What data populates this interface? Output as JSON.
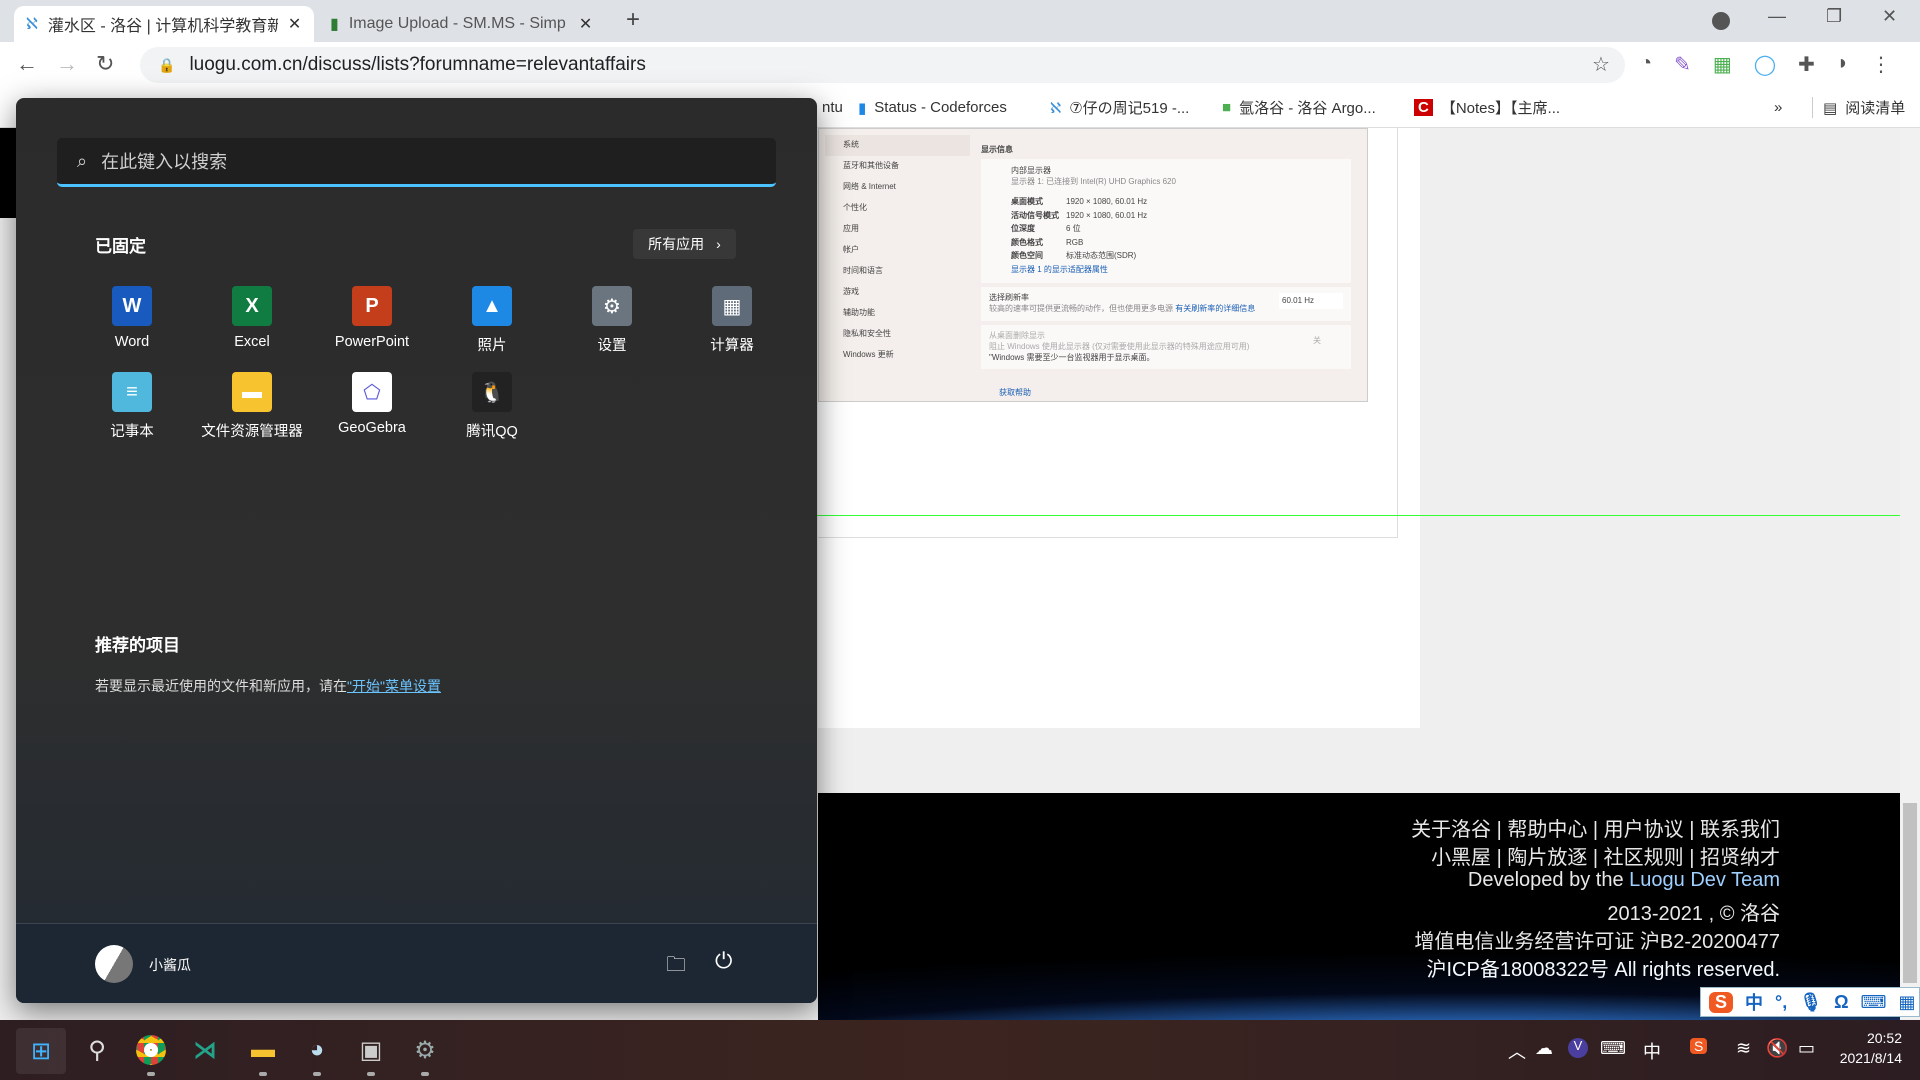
{
  "browser": {
    "tabs": [
      {
        "title": "灌水区 - 洛谷 | 计算机科学教育新",
        "active": true
      },
      {
        "title": "Image Upload - SM.MS - Simp",
        "active": false
      }
    ],
    "new_tab": "+",
    "url": "luogu.com.cn/discuss/lists?forumname=relevantaffairs",
    "bookmarks": [
      "ntu",
      "Status - Codeforces",
      "⑦仔の周记519 -...",
      "氩洛谷 - 洛谷 Argo...",
      "【Notes】【主席..."
    ],
    "more": "»",
    "reading_list": "阅读清单"
  },
  "screenshot_preview": {
    "nav": [
      "系统",
      "蓝牙和其他设备",
      "网络 & Internet",
      "个性化",
      "应用",
      "帐户",
      "时间和语言",
      "游戏",
      "辅助功能",
      "隐私和安全性",
      "Windows 更新"
    ],
    "section": "显示信息",
    "display_name": "内部显示器",
    "display_sub": "显示器 1: 已连接到 Intel(R) UHD Graphics 620",
    "rows": [
      [
        "桌面模式",
        "1920 × 1080, 60.01 Hz"
      ],
      [
        "活动信号模式",
        "1920 × 1080, 60.01 Hz"
      ],
      [
        "位深度",
        "6 位"
      ],
      [
        "颜色格式",
        "RGB"
      ],
      [
        "颜色空间",
        "标准动态范围(SDR)"
      ]
    ],
    "adapter_link": "显示器 1 的显示适配器属性",
    "refresh_title": "选择刷新率",
    "refresh_desc": "较高的速率可提供更流畅的动作，但也使用更多电源",
    "refresh_link": "有关刷新率的详细信息",
    "refresh_value": "60.01 Hz",
    "remove_title": "从桌面删除显示",
    "remove_desc": "阻止 Windows 使用此显示器 (仅对需要使用此显示器的特殊用途应用可用)",
    "remove_note": "\"Windows 需要至少一台监视器用于显示桌面。",
    "toggle": "关",
    "help": "获取帮助"
  },
  "footer": {
    "links1": "关于洛谷 | 帮助中心 | 用户协议 | 联系我们",
    "links2": "小黑屋 | 陶片放逐 | 社区规则 | 招贤纳才",
    "dev_prefix": "Developed by the ",
    "dev_team": "Luogu Dev Team",
    "copyright": "2013-2021 , © 洛谷",
    "license": "增值电信业务经营许可证 沪B2-20200477",
    "icp": "沪ICP备18008322号 All rights reserved."
  },
  "start_menu": {
    "search_placeholder": "在此键入以搜索",
    "pinned_title": "已固定",
    "all_apps": "所有应用",
    "apps": [
      {
        "label": "Word",
        "color": "#185abd",
        "glyph": "W"
      },
      {
        "label": "Excel",
        "color": "#107c41",
        "glyph": "X"
      },
      {
        "label": "PowerPoint",
        "color": "#c43e1c",
        "glyph": "P"
      },
      {
        "label": "照片",
        "color": "#1e88e5",
        "glyph": "▲"
      },
      {
        "label": "设置",
        "color": "#6b7580",
        "glyph": "⚙"
      },
      {
        "label": "计算器",
        "color": "#5f6b78",
        "glyph": "▦"
      },
      {
        "label": "记事本",
        "color": "#4fb8dc",
        "glyph": "≡"
      },
      {
        "label": "文件资源管理器",
        "color": "#f7c32e",
        "glyph": "▬"
      },
      {
        "label": "GeoGebra",
        "color": "#ffffff",
        "glyph": "⬠"
      },
      {
        "label": "腾讯QQ",
        "color": "#222222",
        "glyph": "🐧"
      }
    ],
    "recommended_title": "推荐的项目",
    "recommended_text": "若要显示最近使用的文件和新应用，请在",
    "recommended_link": "\"开始\"菜单设置",
    "user": "小酱瓜"
  },
  "ime": {
    "lang": "中",
    "punct": "°,"
  },
  "taskbar": {
    "tray_lang": "中",
    "time": "20:52",
    "date": "2021/8/14"
  }
}
